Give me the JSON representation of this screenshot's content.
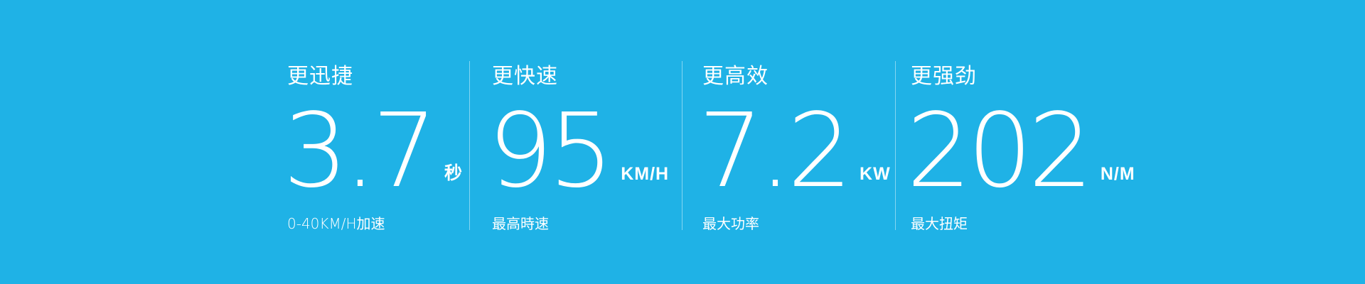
{
  "stats": [
    {
      "heading": "更迅捷",
      "value": "3.7",
      "unit": "秒",
      "caption": "0-40KM/H加速"
    },
    {
      "heading": "更快速",
      "value": "95",
      "unit": "KM/H",
      "caption": "最高時速"
    },
    {
      "heading": "更高效",
      "value": "7.2",
      "unit": "KW",
      "caption": "最大功率"
    },
    {
      "heading": "更强劲",
      "value": "202",
      "unit": "N/M",
      "caption": "最大扭矩"
    }
  ],
  "colors": {
    "background": "#1fb2e6",
    "text": "#ffffff"
  }
}
